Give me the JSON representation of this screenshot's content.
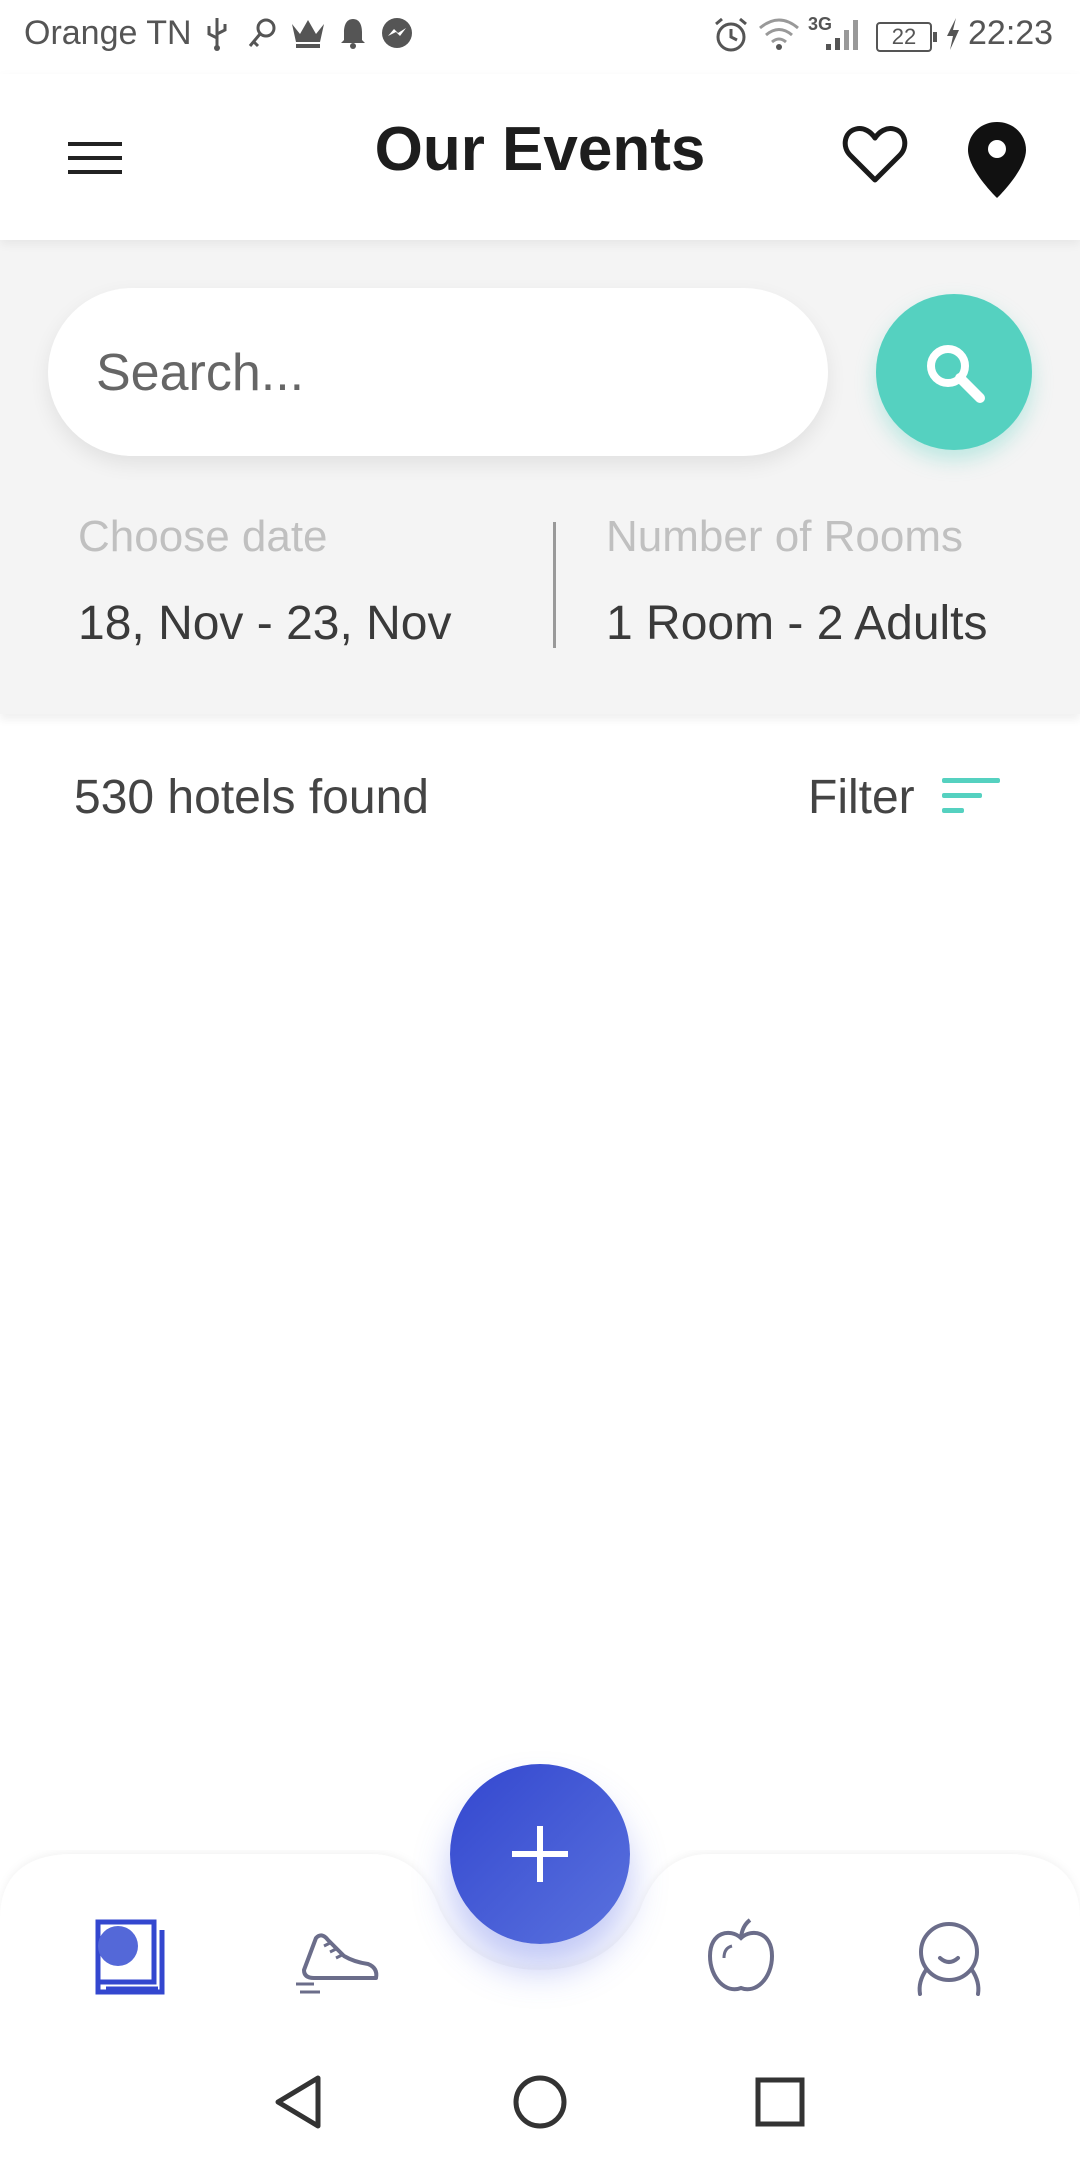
{
  "status_bar": {
    "carrier": "Orange TN",
    "network": "3G",
    "battery": "22",
    "time": "22:23"
  },
  "header": {
    "title": "Our Events"
  },
  "search": {
    "placeholder": "Search...",
    "value": ""
  },
  "date_field": {
    "label": "Choose date",
    "value": "18, Nov - 23, Nov"
  },
  "rooms_field": {
    "label": "Number of Rooms",
    "value": "1 Room - 2 Adults"
  },
  "results": {
    "count_text": "530 hotels found",
    "filter_label": "Filter"
  },
  "bottom_nav": {
    "items": [
      {
        "icon": "book-icon",
        "active": true
      },
      {
        "icon": "sneaker-icon",
        "active": false
      },
      {
        "icon": "apple-icon",
        "active": false
      },
      {
        "icon": "profile-icon",
        "active": false
      }
    ],
    "fab_icon": "plus-icon"
  },
  "colors": {
    "accent_teal": "#55d1c0",
    "fab_blue": "#3347cf",
    "nav_active": "#3347cf",
    "nav_inactive": "#6b6d8a"
  }
}
